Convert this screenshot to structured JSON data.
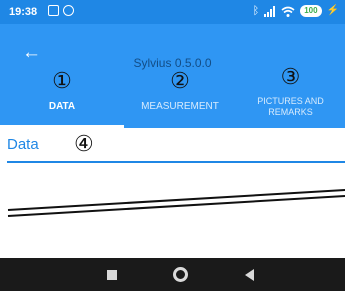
{
  "status_bar": {
    "time": "19:38",
    "left_icons": [
      "notification-square-icon",
      "notification-circle-icon"
    ],
    "right_icons": [
      "bluetooth-icon",
      "signal-icon",
      "wifi-icon"
    ],
    "battery_level": "100",
    "battery_color": "#3cae4c"
  },
  "app_bar": {
    "title": "Sylvius 0.5.0.0",
    "back_icon": "arrow-left-icon",
    "background_color": "#2f96f3"
  },
  "tabs": [
    {
      "marker": "①",
      "label": "DATA",
      "active": true
    },
    {
      "marker": "②",
      "label": "MEASUREMENT",
      "active": false
    },
    {
      "marker": "③",
      "label": "PICTURES AND\nREMARKS",
      "active": false
    }
  ],
  "content": {
    "field_label": "Data",
    "field_marker": "④",
    "accent_color": "#1f87e5"
  },
  "nav_bar": {
    "buttons": [
      "recents-square-icon",
      "home-circle-icon",
      "back-triangle-icon"
    ]
  }
}
